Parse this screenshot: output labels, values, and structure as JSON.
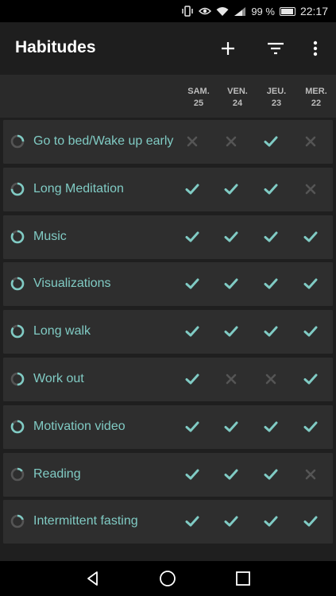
{
  "status_bar": {
    "battery_percent": "99 %",
    "time": "22:17"
  },
  "app_bar": {
    "title": "Habitudes",
    "actions": [
      "add-icon",
      "filter-icon",
      "more-vert-icon"
    ]
  },
  "days": [
    {
      "name": "SAM.",
      "date": "25"
    },
    {
      "name": "VEN.",
      "date": "24"
    },
    {
      "name": "JEU.",
      "date": "23"
    },
    {
      "name": "MER.",
      "date": "22"
    }
  ],
  "colors": {
    "accent": "#80cbc4",
    "unchecked": "#555555",
    "row_bg": "#2e2e2e"
  },
  "habits": [
    {
      "name": "Go to bed/Wake up early",
      "progress": 0.25,
      "checks": [
        false,
        false,
        true,
        false
      ]
    },
    {
      "name": "Long Meditation",
      "progress": 0.75,
      "checks": [
        true,
        true,
        true,
        false
      ]
    },
    {
      "name": "Music",
      "progress": 0.85,
      "checks": [
        true,
        true,
        true,
        true
      ]
    },
    {
      "name": "Visualizations",
      "progress": 0.85,
      "checks": [
        true,
        true,
        true,
        true
      ]
    },
    {
      "name": "Long walk",
      "progress": 0.85,
      "checks": [
        true,
        true,
        true,
        true
      ]
    },
    {
      "name": "Work out",
      "progress": 0.5,
      "checks": [
        true,
        false,
        false,
        true
      ]
    },
    {
      "name": "Motivation video",
      "progress": 0.85,
      "checks": [
        true,
        true,
        true,
        true
      ]
    },
    {
      "name": "Reading",
      "progress": 0.15,
      "checks": [
        true,
        true,
        true,
        false
      ]
    },
    {
      "name": "Intermittent fasting",
      "progress": 0.2,
      "checks": [
        true,
        true,
        true,
        true
      ]
    }
  ],
  "nav_bar": [
    "back-icon",
    "home-icon",
    "recents-icon"
  ]
}
